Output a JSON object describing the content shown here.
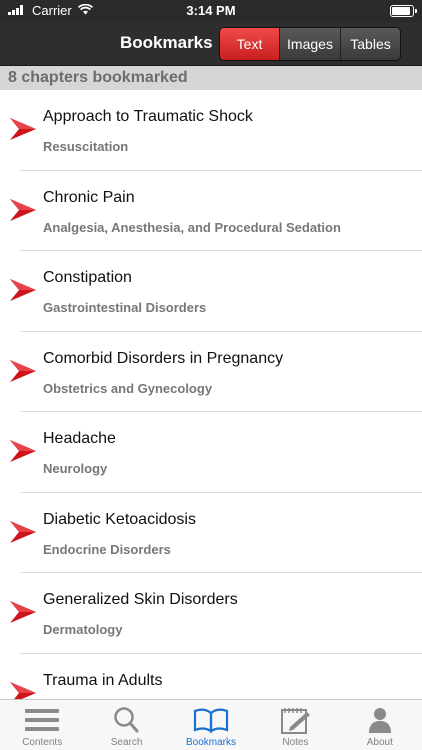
{
  "status": {
    "carrier": "Carrier",
    "time": "3:14 PM",
    "battery_level": 0.95
  },
  "nav": {
    "title": "Bookmarks",
    "segments": [
      {
        "label": "Text",
        "active": true
      },
      {
        "label": "Images",
        "active": false
      },
      {
        "label": "Tables",
        "active": false
      }
    ]
  },
  "section": {
    "header": "8 chapters bookmarked"
  },
  "bookmarks": [
    {
      "title": "Approach to Traumatic Shock",
      "subtitle": "Resuscitation"
    },
    {
      "title": "Chronic Pain",
      "subtitle": "Analgesia, Anesthesia, and Procedural Sedation"
    },
    {
      "title": "Constipation",
      "subtitle": "Gastrointestinal Disorders"
    },
    {
      "title": "Comorbid Disorders in Pregnancy",
      "subtitle": "Obstetrics and Gynecology"
    },
    {
      "title": "Headache",
      "subtitle": "Neurology"
    },
    {
      "title": "Diabetic Ketoacidosis",
      "subtitle": "Endocrine Disorders"
    },
    {
      "title": "Generalized Skin Disorders",
      "subtitle": "Dermatology"
    },
    {
      "title": "Trauma in Adults",
      "subtitle": ""
    }
  ],
  "tabs": [
    {
      "label": "Contents",
      "icon": "list-icon",
      "active": false
    },
    {
      "label": "Search",
      "icon": "search-icon",
      "active": false
    },
    {
      "label": "Bookmarks",
      "icon": "book-icon",
      "active": true
    },
    {
      "label": "Notes",
      "icon": "notepad-icon",
      "active": false
    },
    {
      "label": "About",
      "icon": "person-icon",
      "active": false
    }
  ],
  "colors": {
    "accent": "#1a6fd1",
    "bookmark_arrow": "#d0141c",
    "active_segment": "#e03030"
  }
}
